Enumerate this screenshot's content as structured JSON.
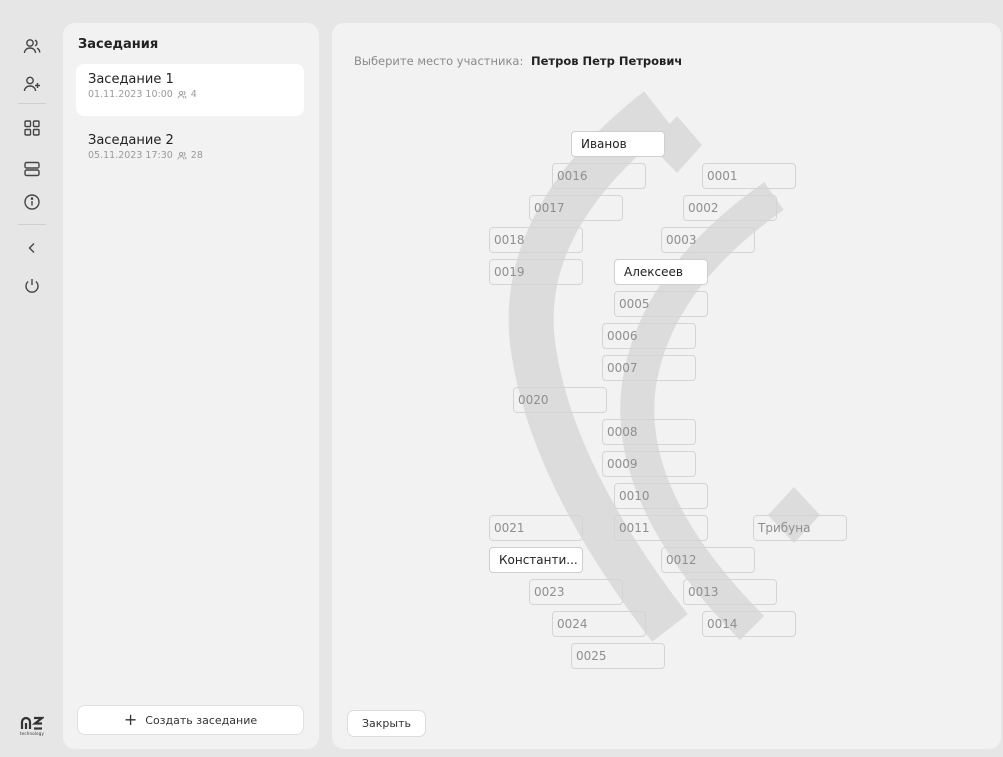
{
  "rail": {
    "logo_text": "technology"
  },
  "meetings": {
    "title": "Заседания",
    "items": [
      {
        "name": "Заседание 1",
        "datetime": "01.11.2023  10:00",
        "count": "4"
      },
      {
        "name": "Заседание 2",
        "datetime": "05.11.2023  17:30",
        "count": "28"
      }
    ],
    "create_label": "Создать заседание"
  },
  "seating": {
    "prompt_label": "Выберите место участника:",
    "participant": "Петров Петр Петрович",
    "close_label": "Закрыть",
    "seats": [
      {
        "label": "Иванов",
        "taken": true
      },
      {
        "label": "0016",
        "taken": false
      },
      {
        "label": "0001",
        "taken": false
      },
      {
        "label": "0017",
        "taken": false
      },
      {
        "label": "0002",
        "taken": false
      },
      {
        "label": "0018",
        "taken": false
      },
      {
        "label": "0003",
        "taken": false
      },
      {
        "label": "0019",
        "taken": false
      },
      {
        "label": "Алексеев",
        "taken": true
      },
      {
        "label": "0005",
        "taken": false
      },
      {
        "label": "0006",
        "taken": false
      },
      {
        "label": "0007",
        "taken": false
      },
      {
        "label": "0020",
        "taken": false
      },
      {
        "label": "0008",
        "taken": false
      },
      {
        "label": "0009",
        "taken": false
      },
      {
        "label": "0010",
        "taken": false
      },
      {
        "label": "0021",
        "taken": false
      },
      {
        "label": "0011",
        "taken": false
      },
      {
        "label": "Трибуна",
        "taken": false
      },
      {
        "label": "Константи...",
        "taken": true
      },
      {
        "label": "0012",
        "taken": false
      },
      {
        "label": "0023",
        "taken": false
      },
      {
        "label": "0013",
        "taken": false
      },
      {
        "label": "0024",
        "taken": false
      },
      {
        "label": "0014",
        "taken": false
      },
      {
        "label": "0025",
        "taken": false
      }
    ]
  }
}
